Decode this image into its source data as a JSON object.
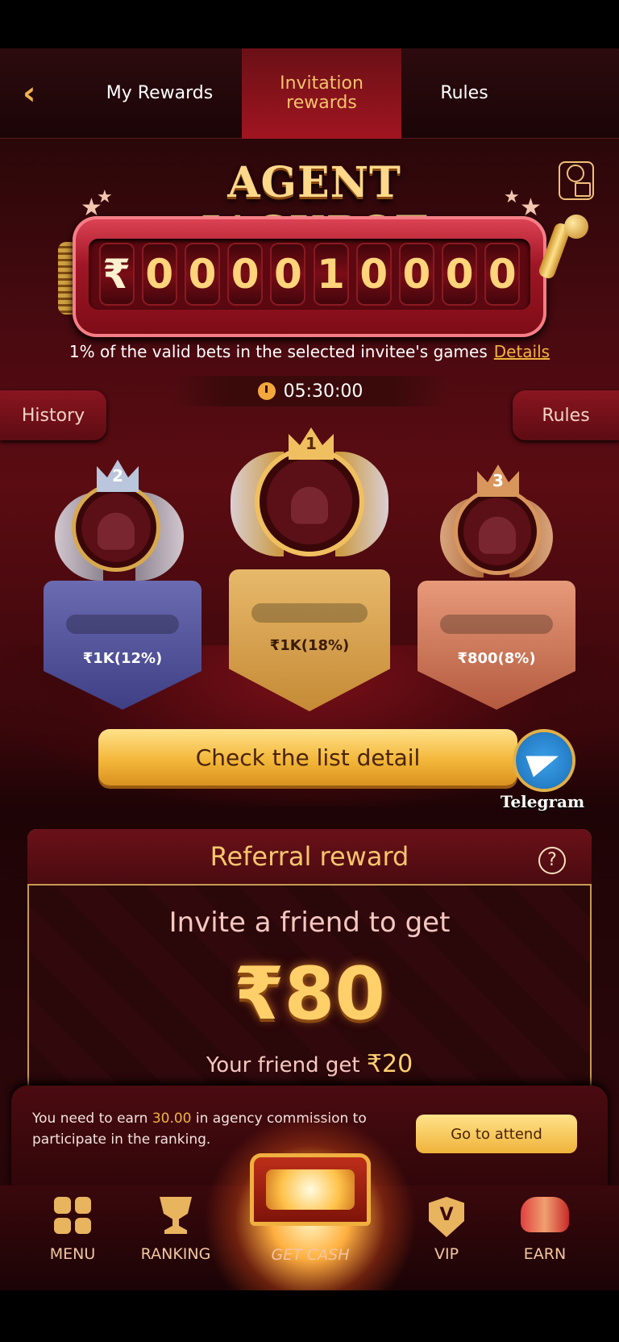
{
  "tabs": {
    "back_icon": "chevron-left-icon",
    "items": [
      "My Rewards",
      "Invitation rewards",
      "Rules"
    ],
    "active": 1
  },
  "jackpot": {
    "title": "AGENT JACKPOT",
    "currency": "₹",
    "digits": [
      "0",
      "0",
      "0",
      "0",
      "1",
      "0",
      "0",
      "0",
      "0"
    ],
    "description": "1% of the valid bets in the selected invitee's games",
    "details_link": "Details",
    "timer": "05:30:00"
  },
  "side_buttons": {
    "history": "History",
    "rules": "Rules"
  },
  "podium": [
    {
      "rank": "2",
      "value": "₹1K(12%)",
      "color": "#5c5ca8"
    },
    {
      "rank": "1",
      "value": "₹1K(18%)",
      "color": "#e0ae5e"
    },
    {
      "rank": "3",
      "value": "₹800(8%)",
      "color": "#d98468"
    }
  ],
  "check_button": "Check the list detail",
  "telegram_label": "Telegram",
  "referral": {
    "title": "Referral reward",
    "help_icon": "?",
    "invite_text": "Invite a friend to get",
    "amount": "₹80",
    "friend_prefix": "Your friend get",
    "friend_amount": "₹20"
  },
  "notice": {
    "prefix": "You need to earn",
    "highlight": "30.00",
    "suffix": "in agency commission to participate in the ranking.",
    "button": "Go to attend"
  },
  "nav": {
    "menu": "MENU",
    "ranking": "RANKING",
    "get_cash": "GET CASH",
    "vip": "VIP",
    "earn": "EARN"
  },
  "colors": {
    "accent": "#f2b441",
    "brand_red": "#a11520",
    "gold_button": "#f3b73a"
  }
}
